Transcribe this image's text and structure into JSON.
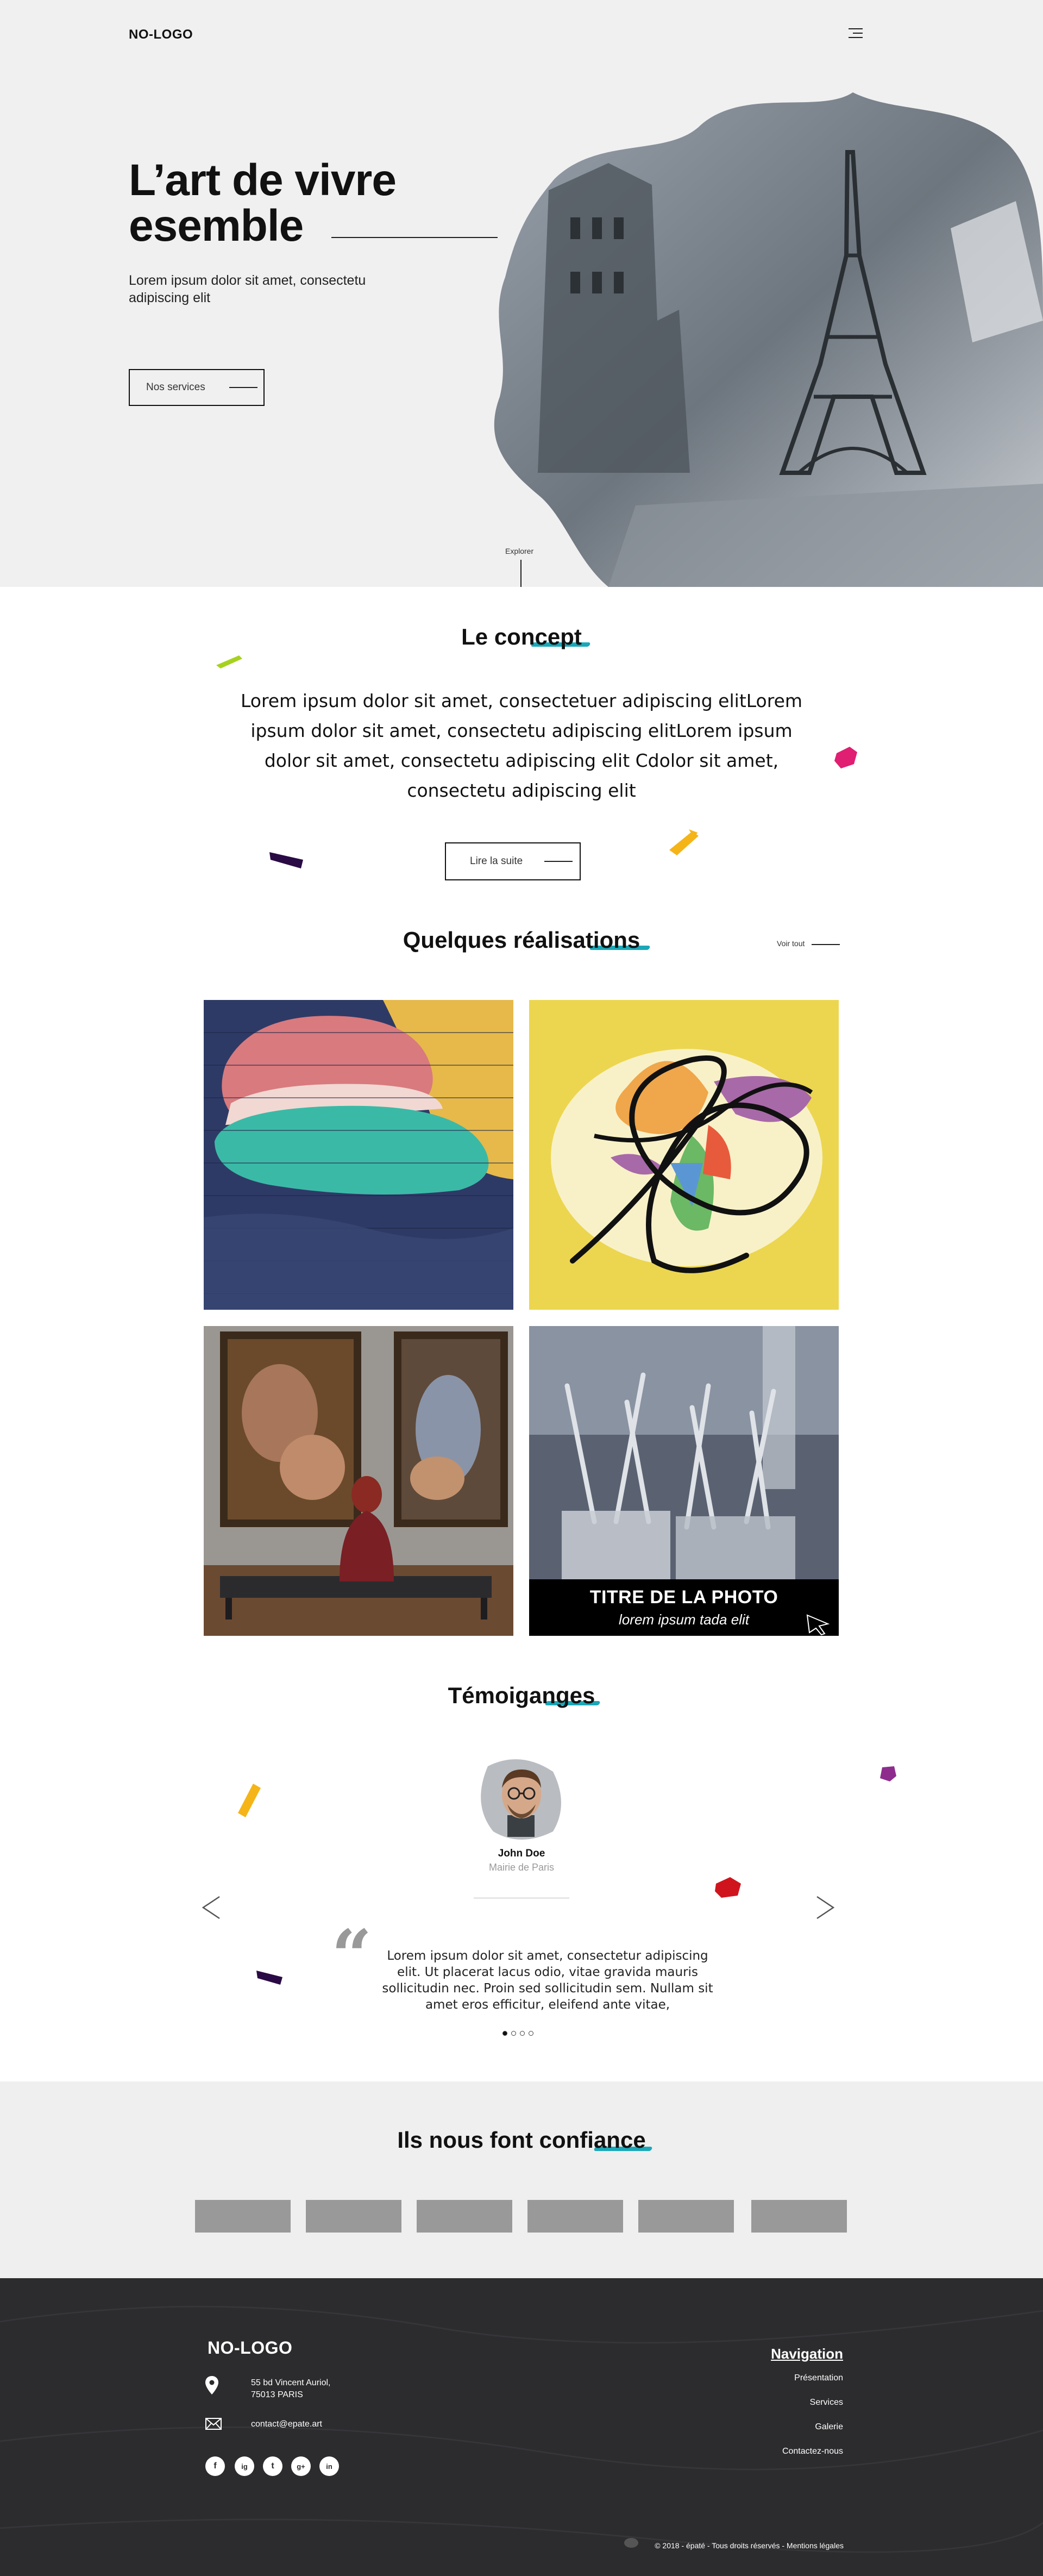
{
  "header": {
    "logo": "NO-LOGO"
  },
  "hero": {
    "title_line1": "L’art de vivre",
    "title_line2": "esemble",
    "subtitle": "Lorem ipsum dolor sit amet, consectetu adipiscing elit",
    "button_label": "Nos services",
    "explore_label": "Explorer"
  },
  "concept": {
    "title": "Le concept",
    "text": "Lorem ipsum dolor sit amet, consectetuer adipiscing elitLorem ipsum dolor sit amet, consectetu adipiscing elitLorem ipsum dolor sit amet, consectetu adipiscing elit Cdolor sit amet, consectetu adipiscing elit",
    "button_label": "Lire la suite"
  },
  "realisations": {
    "title": "Quelques réalisations",
    "see_all": "Voir tout",
    "photo_caption_title": "TITRE DE LA PHOTO",
    "photo_caption_sub": "lorem ipsum tada elit"
  },
  "testimonials": {
    "title": "Témoiganges",
    "person_name": "John Doe",
    "person_role": "Mairie de Paris",
    "quote_mark": "“",
    "quote": "Lorem ipsum dolor sit amet, consectetur adipiscing elit. Ut placerat lacus odio, vitae gravida mauris sollicitudin nec. Proin sed sollicitudin sem. Nullam sit amet eros efficitur, eleifend ante vitae,"
  },
  "clients": {
    "title": "Ils nous font confiance"
  },
  "footer": {
    "logo": "NO-LOGO",
    "address_line1": "55 bd Vincent Auriol,",
    "address_line2": "75013 PARIS",
    "email": "contact@epate.art",
    "social": [
      "f",
      "ig",
      "t",
      "g+",
      "in"
    ],
    "nav_title": "Navigation",
    "nav_items": [
      "Présentation",
      "Services",
      "Galerie",
      "Contactez-nous"
    ],
    "copyright": "© 2018 - épaté - Tous droits réservés - Mentions légales"
  },
  "colors": {
    "accent": "#1aa8b8",
    "hero_bg": "#f0f0f0",
    "clients_bg": "#efefef",
    "footer_bg": "#2c2c2e",
    "client_logo": "#999999"
  }
}
